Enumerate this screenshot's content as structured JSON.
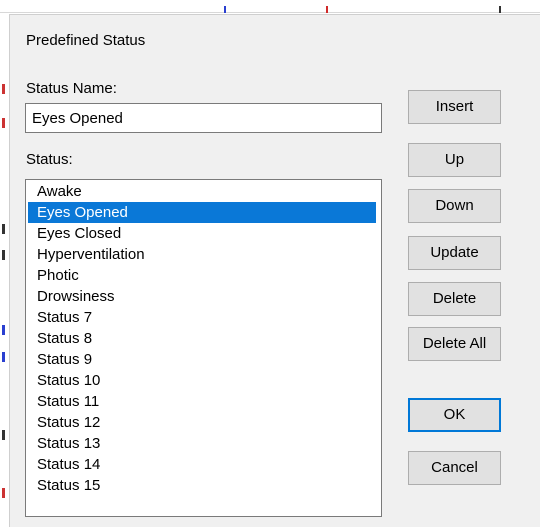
{
  "dialog": {
    "title": "Predefined Status",
    "status_name_label": "Status Name:",
    "status_name_value": "Eyes Opened",
    "status_label": "Status:"
  },
  "status_list": {
    "selected_index": 1,
    "items": [
      "Awake",
      "Eyes Opened",
      "Eyes Closed",
      "Hyperventilation",
      "Photic",
      "Drowsiness",
      "Status 7",
      "Status 8",
      "Status 9",
      "Status 10",
      "Status 11",
      "Status 12",
      "Status 13",
      "Status 14",
      "Status 15"
    ]
  },
  "buttons": {
    "insert": "Insert",
    "up": "Up",
    "down": "Down",
    "update": "Update",
    "delete": "Delete",
    "delete_all": "Delete All",
    "ok": "OK",
    "cancel": "Cancel"
  },
  "colors": {
    "selection": "#0a78d7",
    "dialog_bg": "#f0f0f0",
    "default_button_border": "#0078d7"
  }
}
